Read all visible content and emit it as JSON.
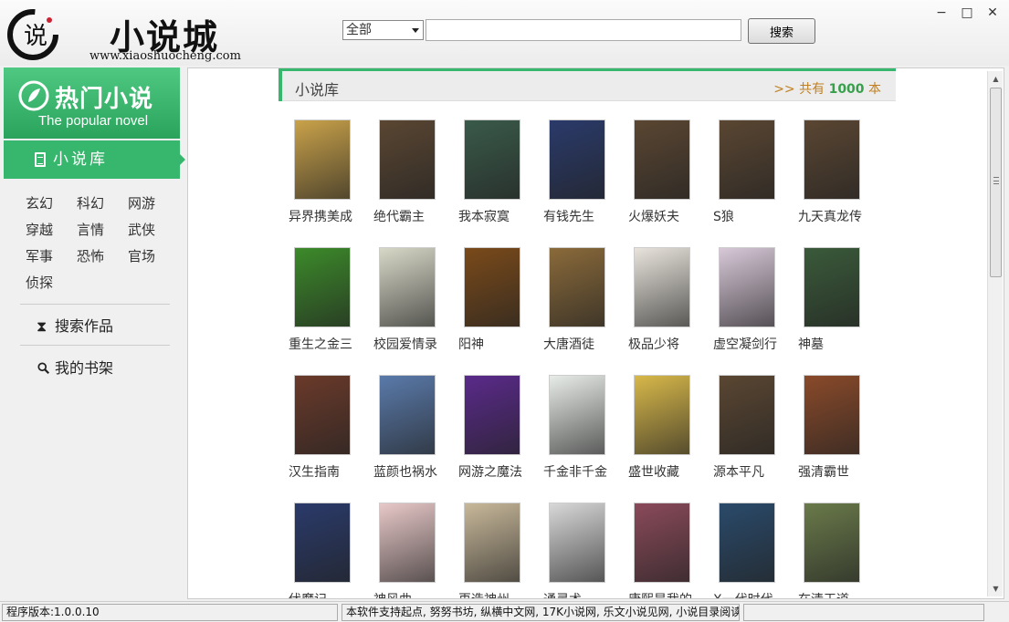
{
  "header": {
    "logo_title": "小说城",
    "logo_url": "www.xiaoshuocheng.com",
    "logo_glyph": "说",
    "search": {
      "select_value": "全部",
      "input_value": "",
      "button_label": "搜索"
    },
    "window_controls": {
      "minimize": "−",
      "maximize": "□",
      "close": "✕"
    }
  },
  "sidebar": {
    "banner_title": "热门小说",
    "banner_subtitle": "The popular novel",
    "active_tab": "小说库",
    "categories": [
      "玄幻",
      "科幻",
      "网游",
      "穿越",
      "言情",
      "武侠",
      "军事",
      "恐怖",
      "官场",
      "侦探"
    ],
    "search_works": "搜索作品",
    "my_shelf": "我的书架"
  },
  "main": {
    "section_title": "小说库",
    "count_prefix": ">> 共有",
    "count_value": "1000",
    "count_suffix": "本",
    "books": [
      {
        "title": "异界携美成",
        "color": "#c9a24a"
      },
      {
        "title": "绝代霸主",
        "color": "#5a4632"
      },
      {
        "title": "我本寂寞",
        "color": "#3a5a4a"
      },
      {
        "title": "有钱先生",
        "color": "#2a3a6a"
      },
      {
        "title": "火爆妖夫",
        "color": "#5a4632"
      },
      {
        "title": "S狼",
        "color": "#5a4632"
      },
      {
        "title": "九天真龙传",
        "color": "#5a4632"
      },
      {
        "title": "重生之金三",
        "color": "#3c8a2a"
      },
      {
        "title": "校园爱情录",
        "color": "#d8d8c8"
      },
      {
        "title": "阳神",
        "color": "#7a4a1a"
      },
      {
        "title": "大唐酒徒",
        "color": "#8a6a3a"
      },
      {
        "title": "极品少将",
        "color": "#e8e4dc"
      },
      {
        "title": "虚空凝剑行",
        "color": "#d8c8d8"
      },
      {
        "title": "神墓",
        "color": "#3a5a3a"
      },
      {
        "title": "汉生指南",
        "color": "#6a3a2a"
      },
      {
        "title": "蓝颜也祸水",
        "color": "#5a7aaa"
      },
      {
        "title": "网游之魔法",
        "color": "#5a2a8a"
      },
      {
        "title": "千金非千金",
        "color": "#e8ece8"
      },
      {
        "title": "盛世收藏",
        "color": "#d8b84a"
      },
      {
        "title": "源本平凡",
        "color": "#5a4632"
      },
      {
        "title": "强清霸世",
        "color": "#8a4a2a"
      },
      {
        "title": "伏魔记",
        "color": "#2a3a6a"
      },
      {
        "title": "神风曲",
        "color": "#e8c8c8"
      },
      {
        "title": "再造神州",
        "color": "#c8b89a"
      },
      {
        "title": "通灵术",
        "color": "#d8d8d8"
      },
      {
        "title": "康熙是我的",
        "color": "#8a4a5a"
      },
      {
        "title": "X一代时代",
        "color": "#2a4a6a"
      },
      {
        "title": "在清王道",
        "color": "#6a7a4a"
      }
    ]
  },
  "status_bar": {
    "version": "程序版本:1.0.0.10",
    "sources": "本软件支持起点, 努努书坊, 纵横中文网, 17K小说网, 乐文小说见网, 小说目录阅读",
    "extra": ""
  }
}
